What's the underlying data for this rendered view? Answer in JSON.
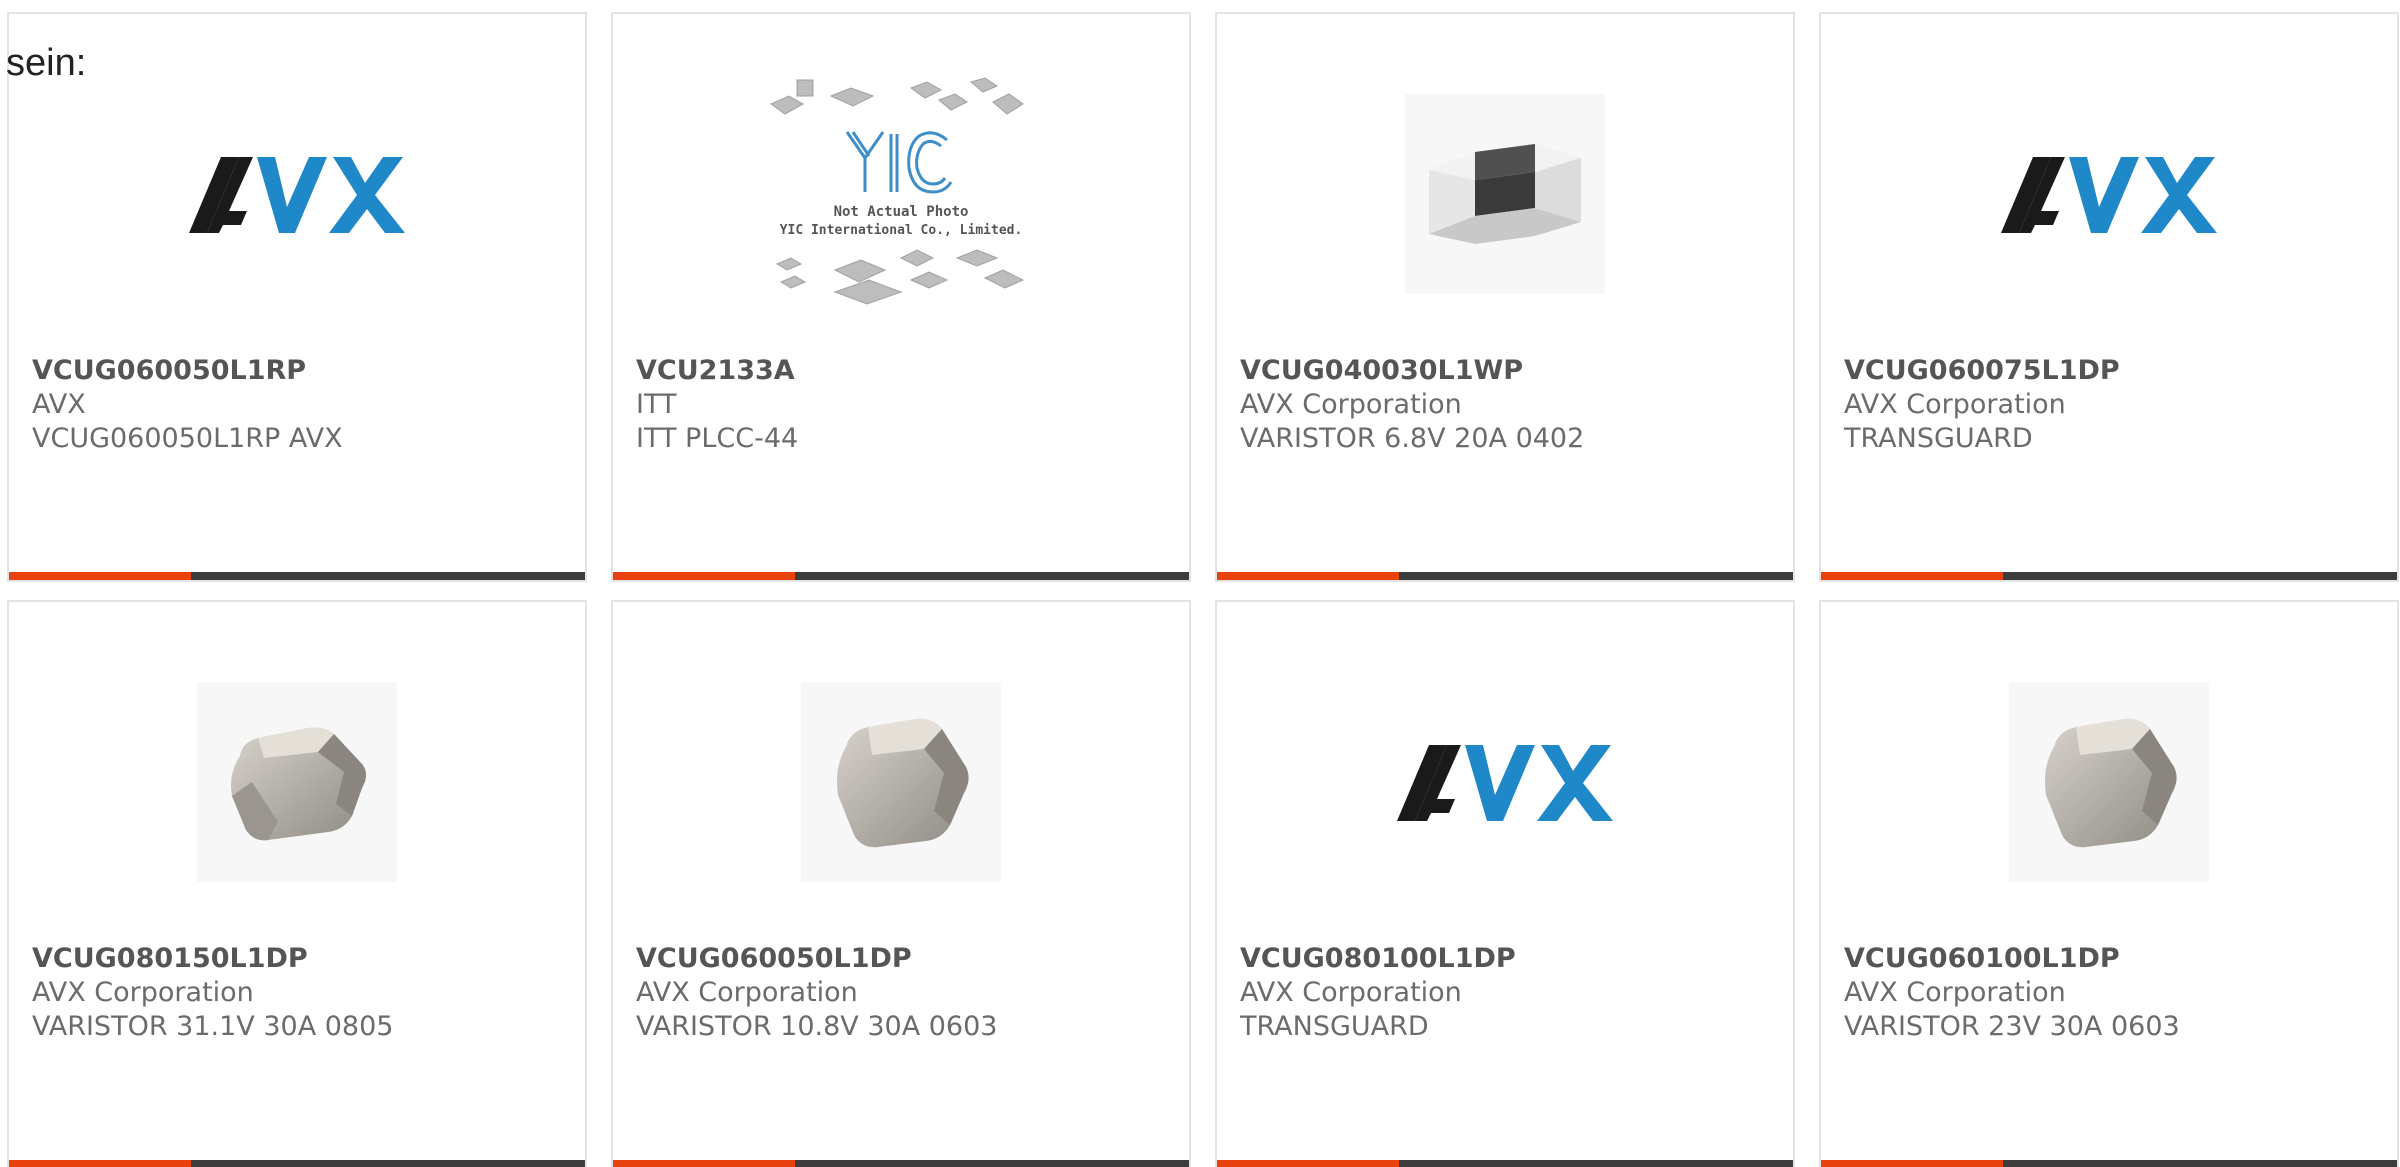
{
  "lead_text": "sein:",
  "colors": {
    "accent": "#e8420f",
    "bar": "#3d3d3d",
    "avx_blue": "#1f88c8",
    "avx_black": "#1a1a1a",
    "yic_blue": "#3e8ec8"
  },
  "yic": {
    "note_line1": "Not Actual Photo",
    "note_line2": "YIC International Co., Limited."
  },
  "products": [
    {
      "part": "VCUG060050L1RP",
      "manufacturer": "AVX",
      "description": "VCUG060050L1RP AVX",
      "image": "avx-logo"
    },
    {
      "part": "VCU2133A",
      "manufacturer": "ITT",
      "description": "ITT PLCC-44",
      "image": "yic-not-actual-photo"
    },
    {
      "part": "VCUG040030L1WP",
      "manufacturer": "AVX Corporation",
      "description": "VARISTOR 6.8V 20A 0402",
      "image": "chip-0402"
    },
    {
      "part": "VCUG060075L1DP",
      "manufacturer": "AVX Corporation",
      "description": "TRANSGUARD",
      "image": "avx-logo"
    },
    {
      "part": "VCUG080150L1DP",
      "manufacturer": "AVX Corporation",
      "description": "VARISTOR 31.1V 30A 0805",
      "image": "chip-0805"
    },
    {
      "part": "VCUG060050L1DP",
      "manufacturer": "AVX Corporation",
      "description": "VARISTOR 10.8V 30A 0603",
      "image": "chip-0603"
    },
    {
      "part": "VCUG080100L1DP",
      "manufacturer": "AVX Corporation",
      "description": "TRANSGUARD",
      "image": "avx-logo"
    },
    {
      "part": "VCUG060100L1DP",
      "manufacturer": "AVX Corporation",
      "description": "VARISTOR 23V 30A 0603",
      "image": "chip-0603"
    }
  ]
}
